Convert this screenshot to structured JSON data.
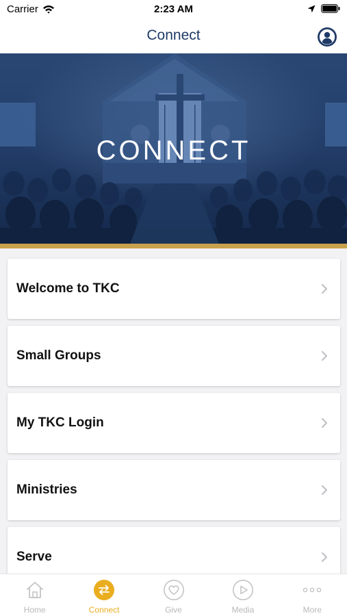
{
  "status": {
    "carrier": "Carrier",
    "time": "2:23 AM"
  },
  "nav": {
    "title": "Connect"
  },
  "hero": {
    "title": "CONNECT"
  },
  "menu": [
    {
      "label": "Welcome to TKC"
    },
    {
      "label": "Small Groups"
    },
    {
      "label": "My TKC Login"
    },
    {
      "label": "Ministries"
    },
    {
      "label": "Serve"
    }
  ],
  "tabs": [
    {
      "label": "Home",
      "icon": "home-icon"
    },
    {
      "label": "Connect",
      "icon": "connect-icon",
      "active": true
    },
    {
      "label": "Give",
      "icon": "heart-icon"
    },
    {
      "label": "Media",
      "icon": "play-icon"
    },
    {
      "label": "More",
      "icon": "more-icon"
    }
  ],
  "colors": {
    "brand_blue": "#1f3a66",
    "accent_gold": "#e9ad1f",
    "stripe_gold": "#c9a04c"
  }
}
